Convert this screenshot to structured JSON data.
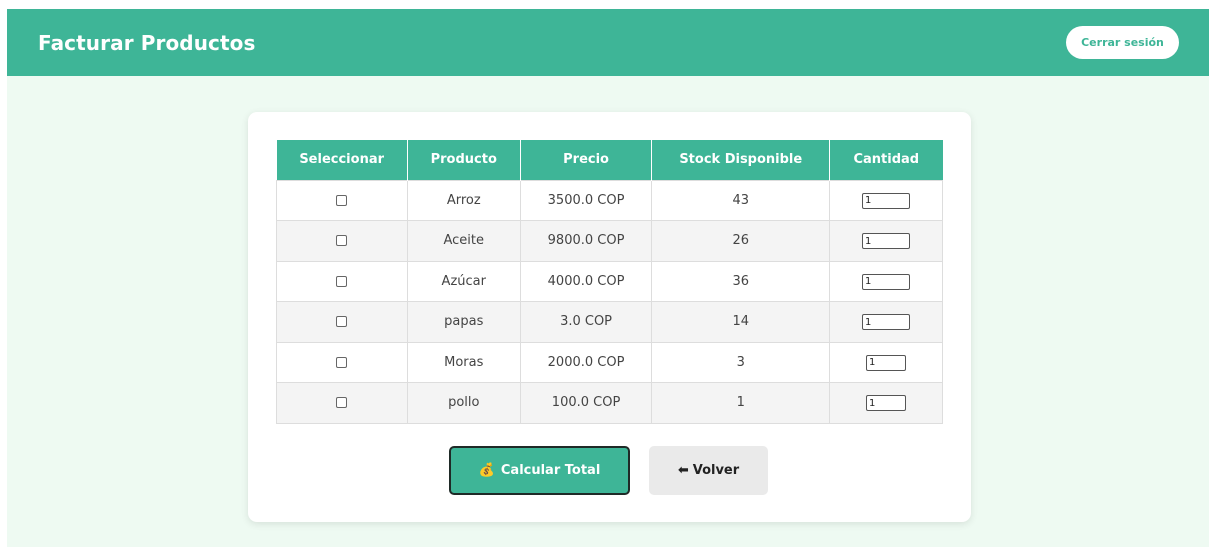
{
  "header": {
    "title": "Facturar Productos",
    "logout_label": "Cerrar sesión"
  },
  "table": {
    "columns": [
      "Seleccionar",
      "Producto",
      "Precio",
      "Stock Disponible",
      "Cantidad"
    ],
    "rows": [
      {
        "selected": false,
        "producto": "Arroz",
        "precio": "3500.0 COP",
        "stock": "43",
        "cantidad": "1"
      },
      {
        "selected": false,
        "producto": "Aceite",
        "precio": "9800.0 COP",
        "stock": "26",
        "cantidad": "1"
      },
      {
        "selected": false,
        "producto": "Azúcar",
        "precio": "4000.0 COP",
        "stock": "36",
        "cantidad": "1"
      },
      {
        "selected": false,
        "producto": "papas",
        "precio": "3.0 COP",
        "stock": "14",
        "cantidad": "1"
      },
      {
        "selected": false,
        "producto": "Moras",
        "precio": "2000.0 COP",
        "stock": "3",
        "cantidad": "1"
      },
      {
        "selected": false,
        "producto": "pollo",
        "precio": "100.0 COP",
        "stock": "1",
        "cantidad": "1"
      }
    ]
  },
  "actions": {
    "calc_icon": "💰",
    "calc_label": "Calcular Total",
    "back_icon": "⬅",
    "back_label": "Volver"
  },
  "colors": {
    "accent": "#3eb597",
    "page_background": "#eefaf2"
  }
}
